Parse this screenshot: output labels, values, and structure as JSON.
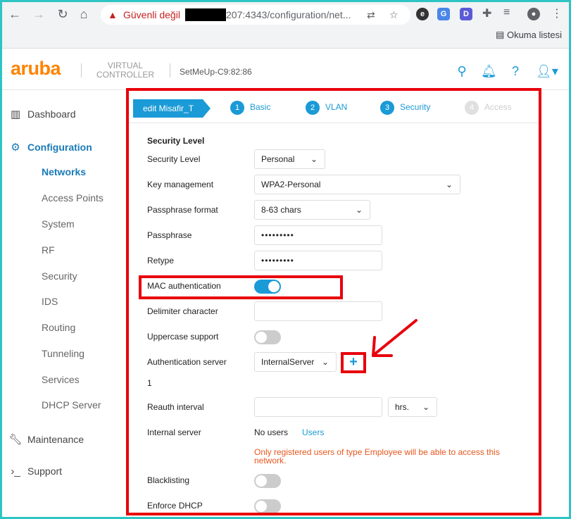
{
  "browser": {
    "warning": "Güvenli değil",
    "url": "207:4343/configuration/net...",
    "bookmark": "Okuma listesi",
    "extensions": [
      "G",
      "D"
    ]
  },
  "header": {
    "logo": "aruba",
    "vc_line1": "VIRTUAL",
    "vc_line2": "CONTROLLER",
    "device": "SetMeUp-C9:82:86"
  },
  "sidebar": {
    "dashboard": "Dashboard",
    "configuration": "Configuration",
    "items": [
      "Networks",
      "Access Points",
      "System",
      "RF",
      "Security",
      "IDS",
      "Routing",
      "Tunneling",
      "Services",
      "DHCP Server"
    ],
    "maintenance": "Maintenance",
    "support": "Support"
  },
  "wizard": {
    "edit_label": "edit Misafir_T",
    "steps": [
      {
        "num": "1",
        "label": "Basic"
      },
      {
        "num": "2",
        "label": "VLAN"
      },
      {
        "num": "3",
        "label": "Security"
      },
      {
        "num": "4",
        "label": "Access"
      }
    ]
  },
  "form": {
    "section_title": "Security Level",
    "security_level_label": "Security Level",
    "security_level_value": "Personal",
    "key_mgmt_label": "Key management",
    "key_mgmt_value": "WPA2-Personal",
    "pass_format_label": "Passphrase format",
    "pass_format_value": "8-63 chars",
    "passphrase_label": "Passphrase",
    "passphrase_value": "•••••••••",
    "retype_label": "Retype",
    "retype_value": "•••••••••",
    "mac_auth_label": "MAC authentication",
    "delimiter_label": "Delimiter character",
    "uppercase_label": "Uppercase support",
    "auth_server_label": "Authentication server",
    "auth_server_value": "InternalServer",
    "auth_count": "1",
    "reauth_label": "Reauth interval",
    "reauth_unit": "hrs.",
    "internal_server_label": "Internal server",
    "no_users": "No users",
    "users_link": "Users",
    "note": "Only registered users of type Employee will be able to access this network.",
    "blacklisting_label": "Blacklisting",
    "enforce_dhcp_label": "Enforce DHCP"
  }
}
